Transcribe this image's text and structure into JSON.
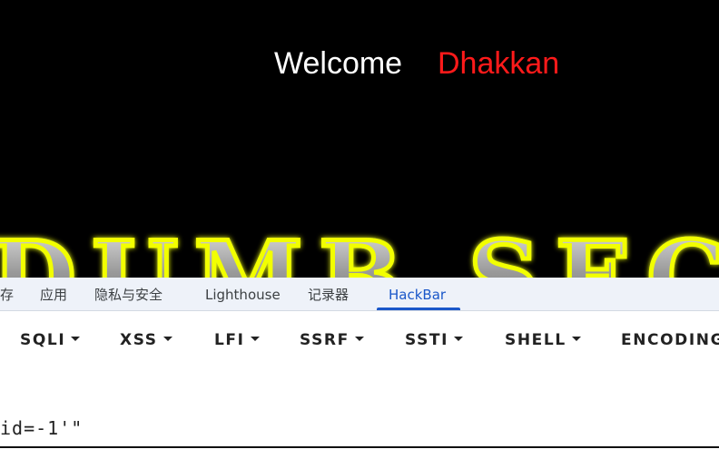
{
  "page": {
    "welcome_label": "Welcome",
    "user_name": "Dhakkan",
    "banner_text": "DUMB SEC"
  },
  "devtools": {
    "tabs": [
      {
        "label": "存"
      },
      {
        "label": "应用"
      },
      {
        "label": "隐私与安全"
      },
      {
        "label": "Lighthouse"
      },
      {
        "label": "记录器"
      },
      {
        "label": "HackBar"
      }
    ],
    "active_tab": "HackBar"
  },
  "hackbar": {
    "menu": [
      {
        "label": "SQLI"
      },
      {
        "label": "XSS"
      },
      {
        "label": "LFI"
      },
      {
        "label": "SSRF"
      },
      {
        "label": "SSTI"
      },
      {
        "label": "SHELL"
      },
      {
        "label": "ENCODING"
      }
    ],
    "url_value": "id=-1'\""
  },
  "colors": {
    "background": "#000000",
    "welcome": "#ffffff",
    "user": "#ff1a1a",
    "tab_active": "#1a57c9",
    "tabbar_bg": "#eef2f9"
  }
}
